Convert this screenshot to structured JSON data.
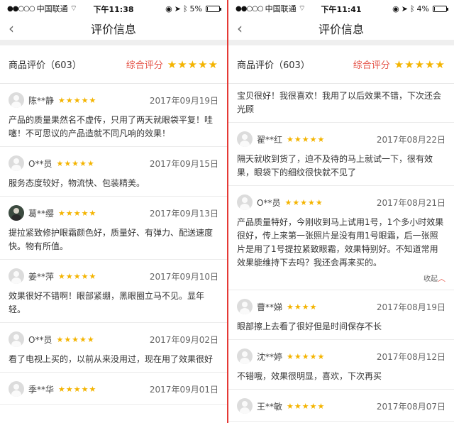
{
  "left": {
    "status": {
      "carrier": "中国联通",
      "time": "下午11:38",
      "battery": "5%",
      "battery_level": 0.05
    },
    "nav": {
      "back": "‹",
      "title": "评价信息"
    },
    "summary": {
      "count_label": "商品评价（603）",
      "overall_label": "综合评分",
      "overall_stars": "★★★★★"
    },
    "reviews": [
      {
        "name": "陈**静",
        "stars": "★★★★★",
        "date": "2017年09月19日",
        "text": "产品的质量果然名不虚传，只用了两天就眼袋平复！哇噻！不可思议的产品造就不同凡响的效果！"
      },
      {
        "name": "O**员",
        "stars": "★★★★★",
        "date": "2017年09月15日",
        "text": "服务态度较好，物流快、包装精美。"
      },
      {
        "name": "葛**缨",
        "stars": "★★★★★",
        "date": "2017年09月13日",
        "text": "提拉紧致修护眼霜颜色好，质量好、有弹力、配送速度快。物有所值。"
      },
      {
        "name": "姜**萍",
        "stars": "★★★★★",
        "date": "2017年09月10日",
        "text": "效果很好不错啊！眼部紧绷，黑眼圈立马不见。显年轻。"
      },
      {
        "name": "O**员",
        "stars": "★★★★★",
        "date": "2017年09月02日",
        "text": "看了电视上买的，以前从来没用过，现在用了效果很好"
      },
      {
        "name": "季**华",
        "stars": "★★★★★",
        "date": "2017年09月01日",
        "text": ""
      }
    ]
  },
  "right": {
    "status": {
      "carrier": "中国联通",
      "time": "下午11:41",
      "battery": "4%",
      "battery_level": 0.04
    },
    "nav": {
      "back": "‹",
      "title": "评价信息"
    },
    "summary": {
      "count_label": "商品评价（603）",
      "overall_label": "综合评分",
      "overall_stars": "★★★★★"
    },
    "continued_text": "宝贝很好！我很喜欢！我用了以后效果不错，下次还会光顾",
    "collapse_label": "收起",
    "reviews": [
      {
        "name": "翟**红",
        "stars": "★★★★★",
        "date": "2017年08月22日",
        "text": "隔天就收到货了，迫不及待的马上就试一下，很有效果，眼袋下的细纹很快就不见了"
      },
      {
        "name": "O**员",
        "stars": "★★★★★",
        "date": "2017年08月21日",
        "text": "产品质量特好，今刚收到马上试用1号，1个多小时效果很好，传上来第一张照片是没有用1号眼霜，后一张照片是用了1号提拉紧致眼霜，效果特别好。不知道常用效果能维持下去吗？我还会再来买的。"
      },
      {
        "name": "曹**娣",
        "stars": "★★★★",
        "date": "2017年08月19日",
        "text": "眼部擦上去看了很好但是时间保存不长"
      },
      {
        "name": "沈**婷",
        "stars": "★★★★★",
        "date": "2017年08月12日",
        "text": "不错哦，效果很明显，喜欢，下次再买"
      },
      {
        "name": "王**敏",
        "stars": "★★★★★",
        "date": "2017年08月07日",
        "text": ""
      }
    ]
  }
}
